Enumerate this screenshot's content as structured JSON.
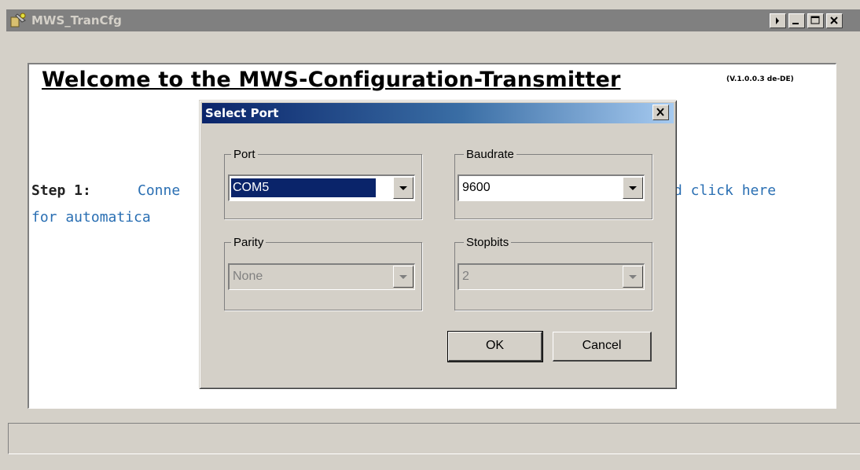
{
  "window": {
    "title": "MWS_TranCfg",
    "controls": [
      "arrow-icon",
      "minimize-icon",
      "maximize-icon",
      "close-icon"
    ]
  },
  "main": {
    "welcome_title": "Welcome to the MWS-Configuration-Transmitter",
    "version": "(V.1.0.0.3 de-DE)",
    "step_label": "Step 1:",
    "step_text_part1": "Conne",
    "step_text_part2": "d click here",
    "step_text_line2": "for automatica"
  },
  "dialog": {
    "title": "Select Port",
    "groups": {
      "port": {
        "label": "Port",
        "value": "COM5",
        "enabled": true,
        "selected": true
      },
      "baudrate": {
        "label": "Baudrate",
        "value": "9600",
        "enabled": true
      },
      "parity": {
        "label": "Parity",
        "value": "None",
        "enabled": false
      },
      "stopbits": {
        "label": "Stopbits",
        "value": "2",
        "enabled": false
      }
    },
    "ok_label": "OK",
    "cancel_label": "Cancel"
  },
  "colors": {
    "dialog_title_gradient_start": "#0a246a",
    "dialog_title_gradient_end": "#a6caf0",
    "selection": "#0a246a",
    "step_text": "#2a6fb3",
    "inactive_title": "#808080"
  }
}
